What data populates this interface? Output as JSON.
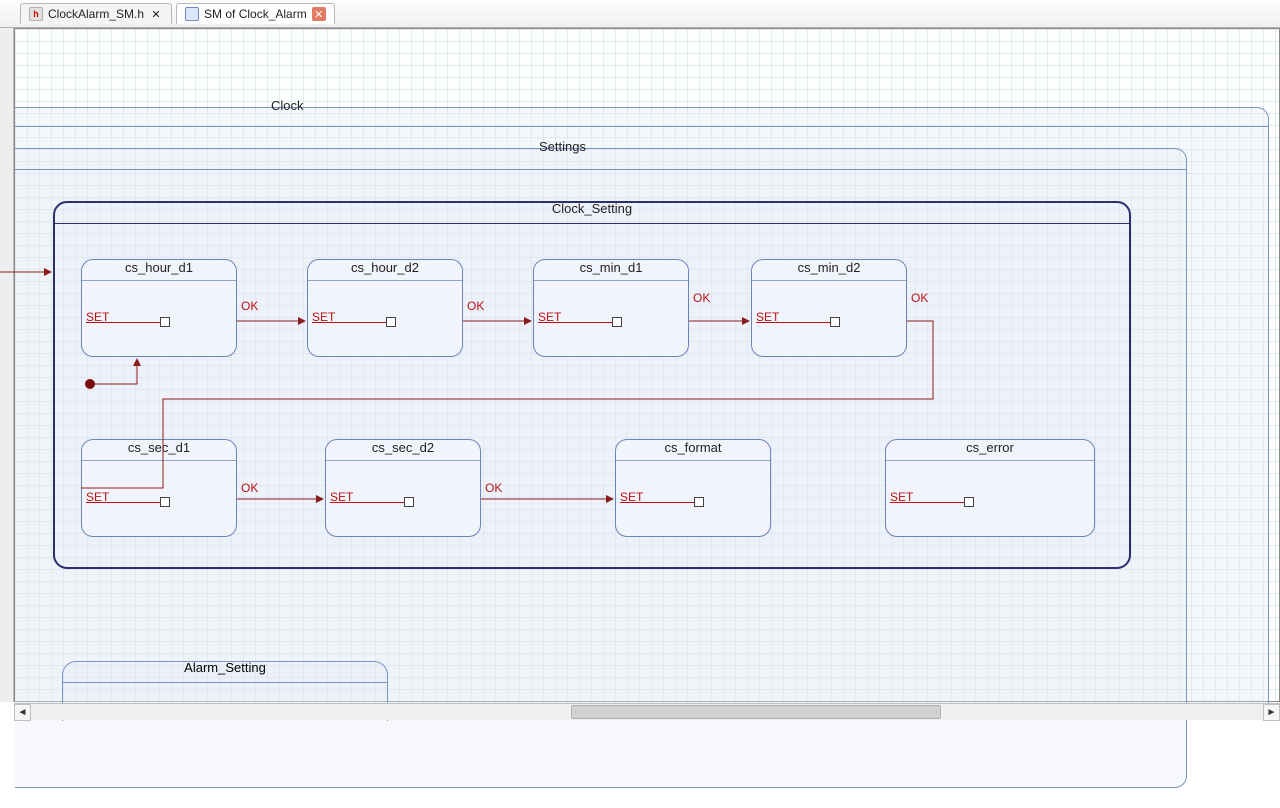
{
  "tabs": [
    {
      "label": "ClockAlarm_SM.h"
    },
    {
      "label": "SM of Clock_Alarm"
    }
  ],
  "clock": {
    "title": "Clock"
  },
  "settings": {
    "title": "Settings"
  },
  "clock_setting": {
    "title": "Clock_Setting"
  },
  "alarm_setting": {
    "title": "Alarm_Setting"
  },
  "transition_labels": {
    "set": "SET",
    "ok": "OK"
  },
  "substates": {
    "row1": [
      {
        "name": "cs_hour_d1"
      },
      {
        "name": "cs_hour_d2"
      },
      {
        "name": "cs_min_d1"
      },
      {
        "name": "cs_min_d2"
      }
    ],
    "row2": [
      {
        "name": "cs_sec_d1"
      },
      {
        "name": "cs_sec_d2"
      },
      {
        "name": "cs_format"
      },
      {
        "name": "cs_error"
      }
    ]
  }
}
